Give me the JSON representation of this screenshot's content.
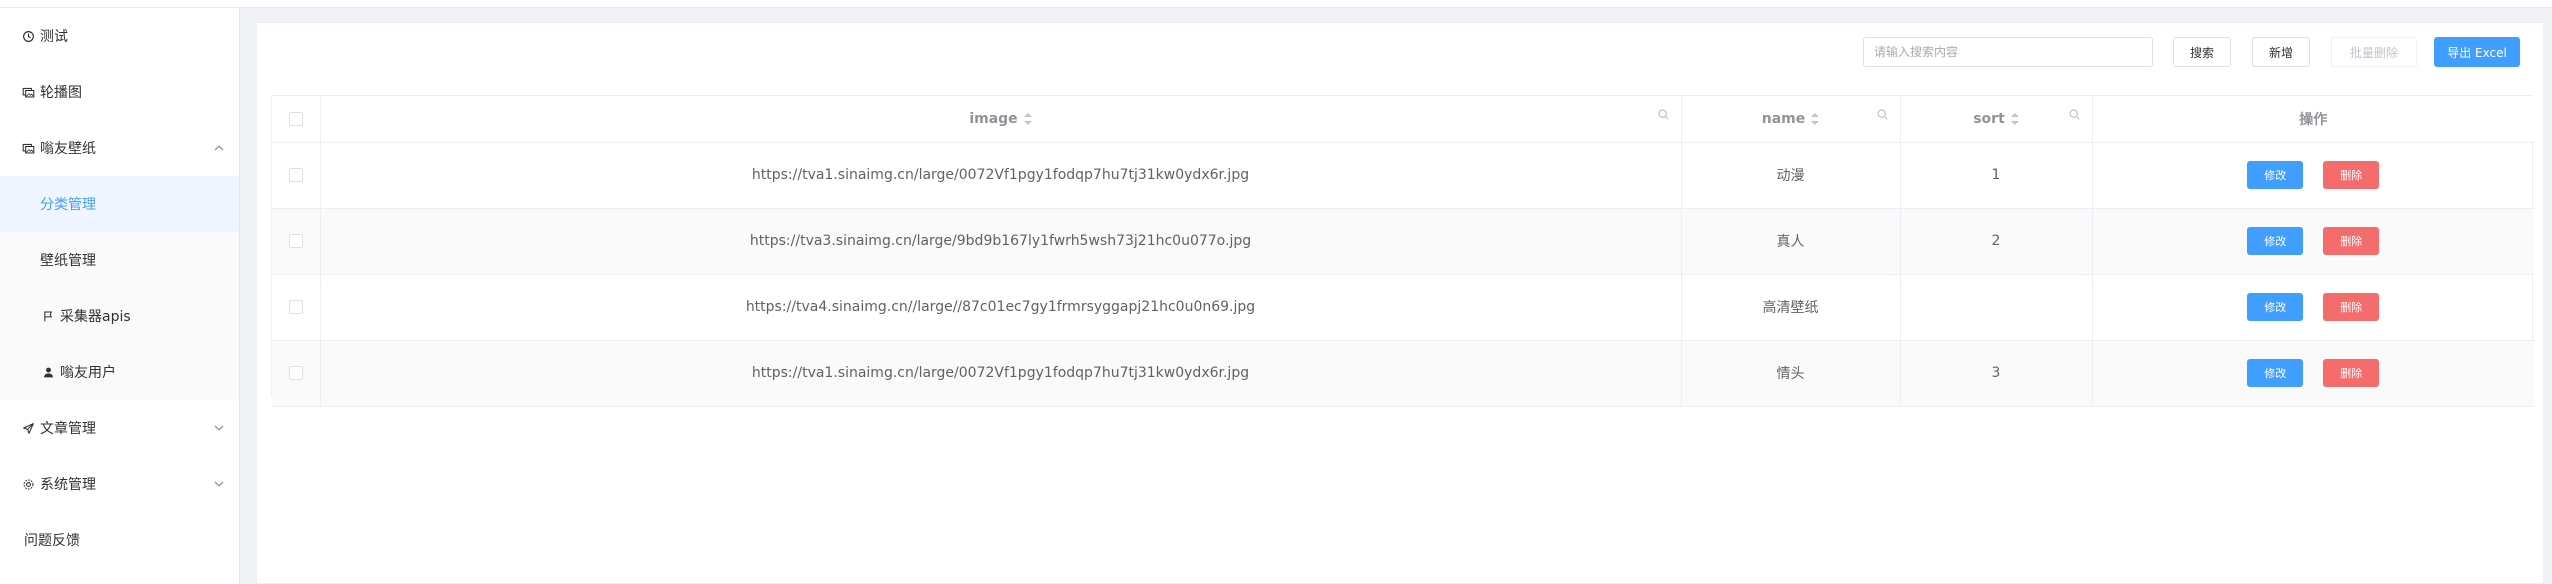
{
  "sidebar": {
    "items": [
      {
        "label": "测试",
        "icon": "clock-icon"
      },
      {
        "label": "轮播图",
        "icon": "images-icon"
      },
      {
        "label": "嗡友壁纸",
        "icon": "images-icon",
        "expanded": true
      },
      {
        "label": "文章管理",
        "icon": "send-icon"
      },
      {
        "label": "系统管理",
        "icon": "gear-icon"
      },
      {
        "label": "问题反馈",
        "icon": ""
      }
    ],
    "submenu": [
      {
        "label": "分类管理",
        "active": true
      },
      {
        "label": "壁纸管理"
      },
      {
        "label": "采集器apis",
        "icon": "flag-icon"
      },
      {
        "label": "嗡友用户",
        "icon": "user-icon"
      }
    ]
  },
  "toolbar": {
    "search_placeholder": "请输入搜索内容",
    "search_label": "搜索",
    "add_label": "新增",
    "batch_delete_label": "批量删除",
    "export_label": "导出 Excel"
  },
  "table": {
    "columns": [
      "image",
      "name",
      "sort",
      "操作"
    ],
    "rows": [
      {
        "image": "https://tva1.sinaimg.cn/large/0072Vf1pgy1fodqp7hu7tj31kw0ydx6r.jpg",
        "name": "动漫",
        "sort": "1"
      },
      {
        "image": "https://tva3.sinaimg.cn/large/9bd9b167ly1fwrh5wsh73j21hc0u077o.jpg",
        "name": "真人",
        "sort": "2"
      },
      {
        "image": "https://tva4.sinaimg.cn//large//87c01ec7gy1frmrsyggapj21hc0u0n69.jpg",
        "name": "高清壁纸",
        "sort": ""
      },
      {
        "image": "https://tva1.sinaimg.cn/large/0072Vf1pgy1fodqp7hu7tj31kw0ydx6r.jpg",
        "name": "情头",
        "sort": "3"
      }
    ],
    "edit_label": "修改",
    "delete_label": "删除"
  },
  "colors": {
    "primary": "#409eff",
    "danger": "#f56c6c",
    "active_menu": "#409eff"
  }
}
